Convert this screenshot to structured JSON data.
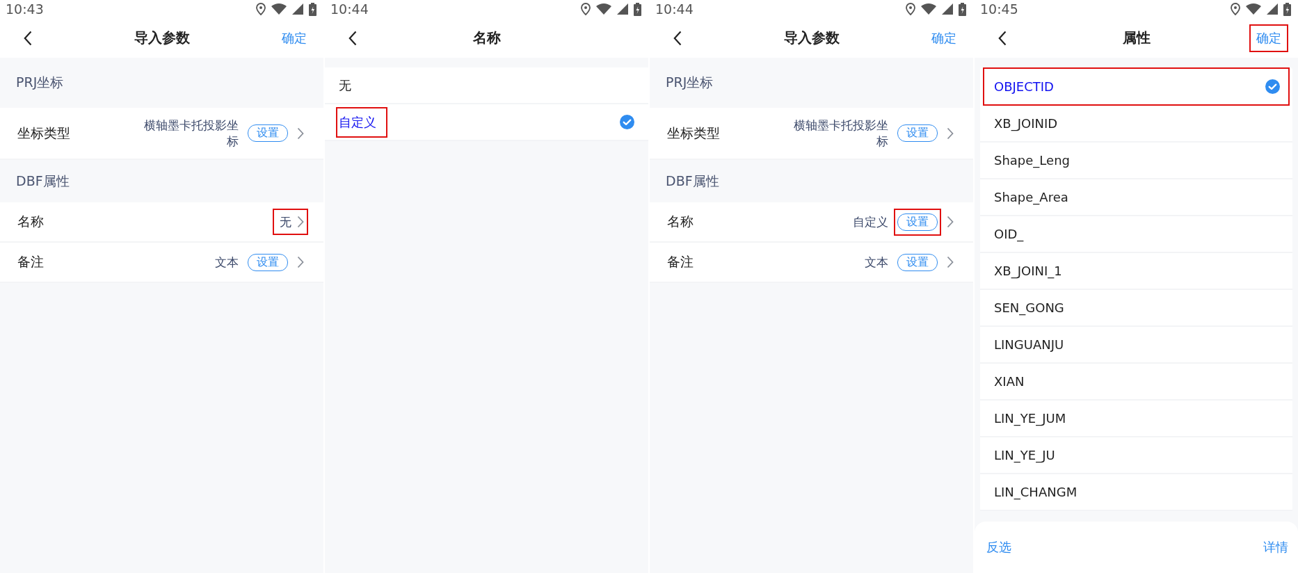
{
  "screens": [
    {
      "kind": "params",
      "time": "10:43",
      "title": "导入参数",
      "confirm": {
        "label": "确定",
        "highlighted": false
      },
      "sections": [
        {
          "header": "PRJ坐标",
          "rows": [
            {
              "label": "坐标类型",
              "value": "横轴墨卡托投影坐标",
              "highlighted": false,
              "button": {
                "label": "设置",
                "highlighted": false
              }
            }
          ]
        },
        {
          "header": "DBF属性",
          "rows": [
            {
              "label": "名称",
              "value": "无",
              "highlighted": true
            },
            {
              "label": "备注",
              "value": "文本",
              "highlighted": false,
              "button": {
                "label": "设置",
                "highlighted": false
              }
            }
          ]
        }
      ]
    },
    {
      "kind": "options",
      "time": "10:44",
      "title": "名称",
      "inset": false,
      "options": [
        {
          "label": "无",
          "selected": false,
          "highlighted": false
        },
        {
          "label": "自定义",
          "selected": true,
          "highlighted": true
        }
      ]
    },
    {
      "kind": "params",
      "time": "10:44",
      "title": "导入参数",
      "confirm": {
        "label": "确定",
        "highlighted": false
      },
      "sections": [
        {
          "header": "PRJ坐标",
          "rows": [
            {
              "label": "坐标类型",
              "value": "横轴墨卡托投影坐标",
              "highlighted": false,
              "button": {
                "label": "设置",
                "highlighted": false
              }
            }
          ]
        },
        {
          "header": "DBF属性",
          "rows": [
            {
              "label": "名称",
              "value": "自定义",
              "highlighted": false,
              "button": {
                "label": "设置",
                "highlighted": true
              }
            },
            {
              "label": "备注",
              "value": "文本",
              "highlighted": false,
              "button": {
                "label": "设置",
                "highlighted": false
              }
            }
          ]
        }
      ]
    },
    {
      "kind": "options",
      "time": "10:45",
      "title": "属性",
      "inset": true,
      "confirm": {
        "label": "确定",
        "highlighted": true
      },
      "options": [
        {
          "label": "OBJECTID",
          "selected": true,
          "highlighted": true
        },
        {
          "label": "XB_JOINID",
          "selected": false,
          "highlighted": false
        },
        {
          "label": "Shape_Leng",
          "selected": false,
          "highlighted": false
        },
        {
          "label": "Shape_Area",
          "selected": false,
          "highlighted": false
        },
        {
          "label": "OID_",
          "selected": false,
          "highlighted": false
        },
        {
          "label": "XB_JOINI_1",
          "selected": false,
          "highlighted": false
        },
        {
          "label": "SEN_GONG",
          "selected": false,
          "highlighted": false
        },
        {
          "label": "LINGUANJU",
          "selected": false,
          "highlighted": false
        },
        {
          "label": "XIAN",
          "selected": false,
          "highlighted": false
        },
        {
          "label": "LIN_YE_JUM",
          "selected": false,
          "highlighted": false
        },
        {
          "label": "LIN_YE_JU",
          "selected": false,
          "highlighted": false
        },
        {
          "label": "LIN_CHANGM",
          "selected": false,
          "highlighted": false
        }
      ],
      "footer": [
        "反选",
        "详情"
      ]
    }
  ]
}
